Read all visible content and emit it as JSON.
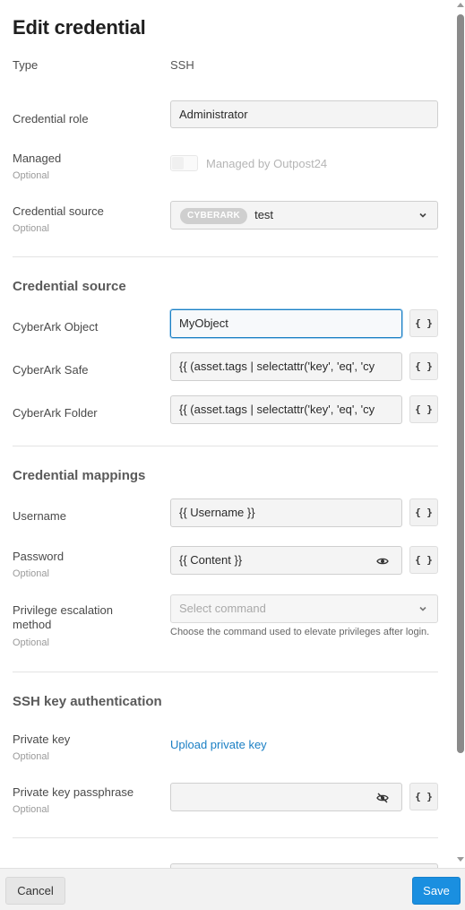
{
  "dialog": {
    "title": "Edit credential"
  },
  "general": {
    "type_label": "Type",
    "type_value": "SSH",
    "role_label": "Credential role",
    "role_value": "Administrator",
    "managed_label": "Managed",
    "managed_optional": "Optional",
    "managed_toggle_label": "Managed by Outpost24",
    "managed_checked": false,
    "source_label": "Credential source",
    "source_optional": "Optional",
    "source_badge": "CYBERARK",
    "source_value": "test"
  },
  "credential_source": {
    "title": "Credential source",
    "object_label": "CyberArk Object",
    "object_value": "MyObject",
    "safe_label": "CyberArk Safe",
    "safe_value": "{{ (asset.tags | selectattr('key', 'eq', 'cy",
    "folder_label": "CyberArk Folder",
    "folder_value": "{{ (asset.tags | selectattr('key', 'eq', 'cy",
    "template_button": "{ }"
  },
  "mappings": {
    "title": "Credential mappings",
    "username_label": "Username",
    "username_value": "{{ Username }}",
    "password_label": "Password",
    "password_optional": "Optional",
    "password_value": "{{ Content }}",
    "escalation_label": "Privilege escalation method",
    "escalation_optional": "Optional",
    "escalation_placeholder": "Select command",
    "escalation_helper": "Choose the command used to elevate privileges after login."
  },
  "ssh": {
    "title": "SSH key authentication",
    "private_key_label": "Private key",
    "private_key_optional": "Optional",
    "upload_link": "Upload private key",
    "passphrase_label": "Private key passphrase",
    "passphrase_optional": "Optional",
    "passphrase_value": ""
  },
  "footer": {
    "cancel_label": "Cancel",
    "save_label": "Save"
  },
  "colors": {
    "accent": "#1a8fe0",
    "focus_border": "#1a7fc4",
    "link": "#1a7fc4"
  },
  "icons": {
    "chevron": "chevron-down-icon",
    "eye": "eye-icon",
    "eye_off": "eye-off-icon"
  }
}
